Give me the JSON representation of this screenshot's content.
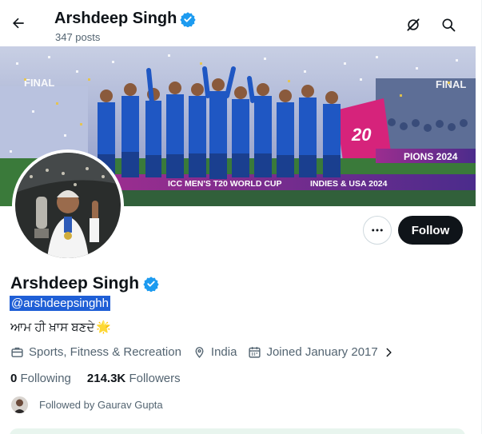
{
  "header": {
    "name": "Arshdeep Singh",
    "posts_count": "347 posts"
  },
  "banner": {
    "caption": "ICC MEN'S T20 WORLD CUP",
    "caption_right": "INDIES & USA 2024",
    "sign_left": "FINAL",
    "sign_right": "PIONS 2024",
    "sign_board": "20"
  },
  "profile": {
    "display_name": "Arshdeep Singh",
    "handle": "@arshdeepsinghh",
    "bio": "ਆਮ ਹੀ ਖ਼ਾਸ ਬਣਦੇ",
    "bio_emoji": "🌟",
    "category": "Sports, Fitness & Recreation",
    "location": "India",
    "joined": "Joined January 2017",
    "following_count": "0",
    "following_label": "Following",
    "followers_count": "214.3K",
    "followers_label": "Followers",
    "followed_by": "Followed by Gaurav Gupta"
  },
  "actions": {
    "follow_label": "Follow"
  },
  "colors": {
    "verified": "#1d9bf0",
    "follow_bg": "#0f1419",
    "muted_text": "#536471",
    "selection": "#1f5fd6"
  }
}
